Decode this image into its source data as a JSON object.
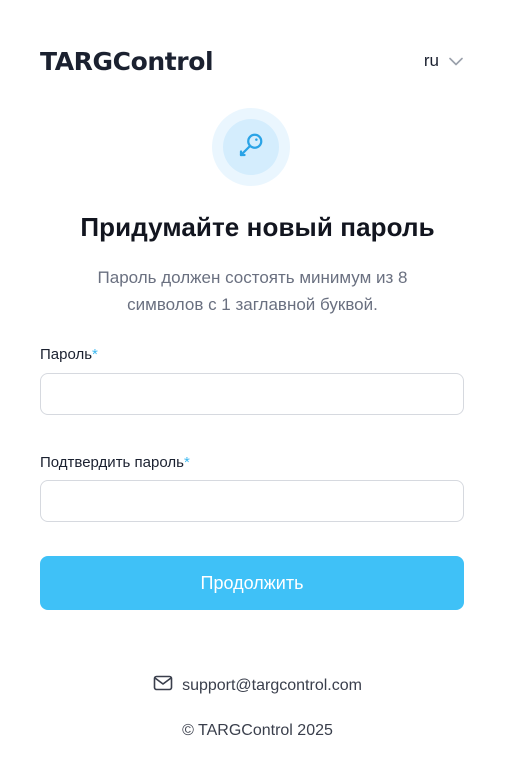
{
  "header": {
    "logo": "TARGControl",
    "language": "ru"
  },
  "icons": {
    "key": "key-icon",
    "language_chevron": "chevron-down-icon",
    "mail": "mail-icon"
  },
  "main": {
    "title": "Придумайте новый пароль",
    "subtitle_line1": "Пароль должен состоять минимум из 8",
    "subtitle_line2": "символов с 1 заглавной буквой."
  },
  "form": {
    "password_label": "Пароль",
    "confirm_label": "Подтвердить пароль",
    "required_mark": "*",
    "password_value": "",
    "confirm_value": "",
    "submit_label": "Продолжить"
  },
  "footer": {
    "support_email": "support@targcontrol.com",
    "copyright": "© TARGControl 2025"
  },
  "colors": {
    "accent": "#3fc1f7",
    "required": "#3bb8f0",
    "badge_outer": "#eaf6fe",
    "badge_inner": "#d4edfd",
    "key_icon": "#2aa3e6"
  }
}
